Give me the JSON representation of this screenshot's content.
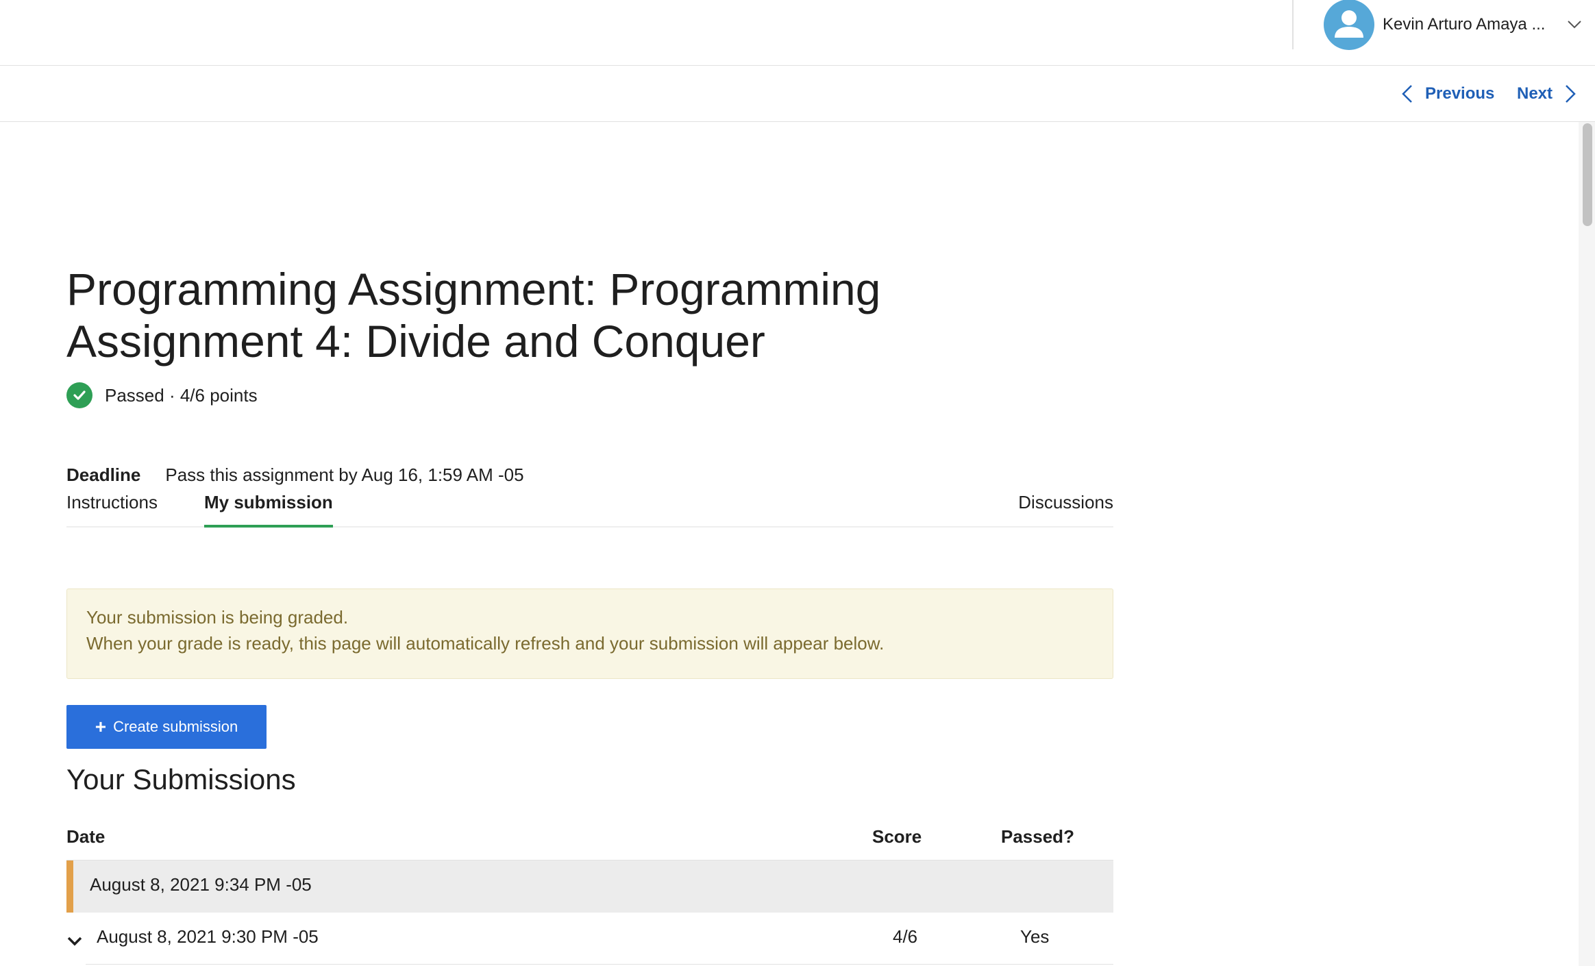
{
  "header": {
    "user_name": "Kevin Arturo Amaya ..."
  },
  "subnav": {
    "previous_label": "Previous",
    "next_label": "Next"
  },
  "assignment": {
    "title": "Programming Assignment: Programming Assignment 4: Divide and Conquer",
    "status": "Passed · 4/6 points",
    "deadline_label": "Deadline",
    "deadline_text": "Pass this assignment by Aug 16, 1:59 AM -05"
  },
  "tabs": [
    {
      "label": "Instructions",
      "active": false
    },
    {
      "label": "My submission",
      "active": true
    },
    {
      "label": "Discussions",
      "active": false
    }
  ],
  "alert": {
    "line1": "Your submission is being graded.",
    "line2": "When your grade is ready, this page will automatically refresh and your submission will appear below."
  },
  "create_button": {
    "label": "Create submission"
  },
  "submissions": {
    "title": "Your Submissions",
    "columns": [
      "Date",
      "Score",
      "Passed?"
    ],
    "rows": [
      {
        "date": "August 8, 2021 9:34 PM -05",
        "score": "",
        "passed": "",
        "pending": true
      },
      {
        "date": "August 8, 2021 9:30 PM -05",
        "score": "4/6",
        "passed": "Yes",
        "pending": false
      }
    ]
  },
  "colors": {
    "accent_blue": "#1f5fb6",
    "button_blue": "#2a6fdb",
    "success_green": "#2e9f55",
    "pending_orange": "#e2a04a",
    "alert_bg": "#f9f6e4",
    "alert_text": "#7a6a2f"
  },
  "icons": [
    "user-avatar-icon",
    "chevron-down-icon",
    "chevron-left-icon",
    "chevron-right-icon",
    "check-circle-icon",
    "plus-icon",
    "chevron-expand-icon"
  ]
}
